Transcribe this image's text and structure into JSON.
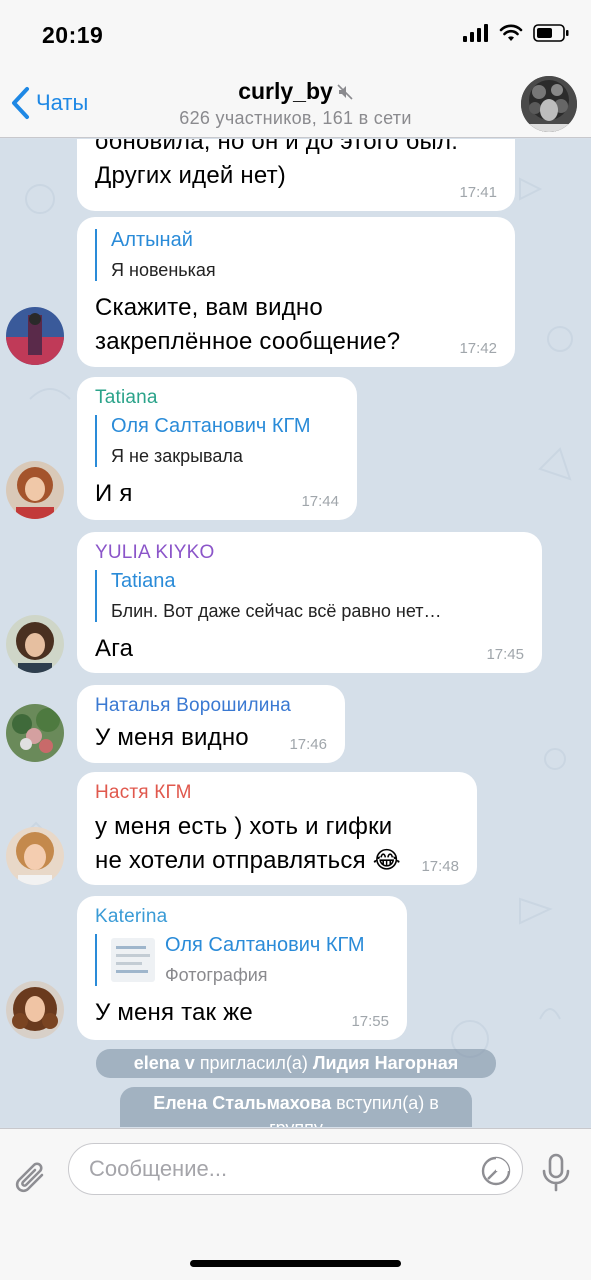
{
  "status_bar": {
    "time": "20:19"
  },
  "nav": {
    "back_label": "Чаты",
    "title": "curly_by",
    "subtitle": "626 участников, 161 в сети"
  },
  "messages": [
    {
      "text": "обновила, но он и до этого был. Других идей нет)",
      "time": "17:41"
    },
    {
      "reply_name": "Алтынай",
      "reply_text": "Я новенькая",
      "text": "Скажите, вам видно закреплённое сообщение?",
      "time": "17:42"
    },
    {
      "sender": "Tatiana",
      "reply_name": "Оля Салтанович КГМ",
      "reply_text": "Я не закрывала",
      "text": "И я",
      "time": "17:44"
    },
    {
      "sender": "YULIA KIYKO",
      "reply_name": "Tatiana",
      "reply_text": "Блин. Вот даже сейчас всё равно нет…",
      "text": "Ага",
      "time": "17:45"
    },
    {
      "sender": "Наталья Ворошилина",
      "text": "У меня видно",
      "time": "17:46"
    },
    {
      "sender": "Настя КГМ",
      "text": "у меня есть ) хоть и гифки не хотели отправляться 😂",
      "time": "17:48"
    },
    {
      "sender": "Katerina",
      "reply_name": "Оля Салтанович КГМ",
      "reply_text": "Фотография",
      "text": "У меня так же",
      "time": "17:55"
    }
  ],
  "service_messages": [
    {
      "actor": "elena v",
      "action": "пригласил(а)",
      "target": "Лидия Нагорная"
    },
    {
      "actor": "Елена Стальмахова",
      "action": "вступил(а) в группу"
    }
  ],
  "input": {
    "placeholder": "Сообщение..."
  },
  "colors": {
    "accent": "#1e88e5",
    "tatiana": "#2ba38a",
    "yulia": "#8b55c9",
    "natalya": "#3a79d2",
    "nastya": "#e0584d",
    "katerina": "#3a9bd6",
    "reply": "#2a8bd8"
  }
}
